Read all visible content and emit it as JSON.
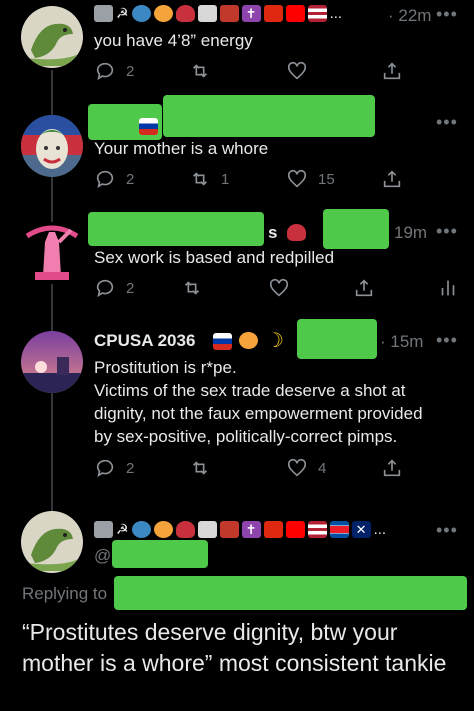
{
  "tweets": [
    {
      "text": "you have 4’8” energy",
      "time": "· 22m",
      "replies": "2",
      "retweets": "",
      "likes": "",
      "more": "•••"
    },
    {
      "text": "Your mother is a whore",
      "time": "",
      "replies": "2",
      "retweets": "1",
      "likes": "15",
      "more": "•••"
    },
    {
      "text": "Sex work is based and redpilled",
      "name_fragment": "s",
      "time": "19m",
      "replies": "2",
      "retweets": "",
      "likes": "",
      "more": "•••"
    },
    {
      "name": "CPUSA 2036",
      "time": "· 15m",
      "text_lines": [
        "Prostitution is r*pe.",
        "Victims of the sex trade deserve a shot at",
        "dignity, not the faux empowerment provided",
        "by sex-positive, politically-correct pimps."
      ],
      "replies": "2",
      "retweets": "",
      "likes": "4",
      "more": "•••"
    },
    {
      "handle_prefix": "@",
      "replying_to": "Replying to",
      "quote": "“Prostitutes deserve dignity, btw your mother is a whore” most consistent tankie",
      "more": "•••"
    }
  ],
  "emoji_ellipsis": "...",
  "icons": [
    "reply-icon",
    "retweet-icon",
    "like-icon",
    "share-icon",
    "analytics-icon"
  ],
  "colors": {
    "background": "#000000",
    "text": "#e7e9ea",
    "muted": "#71767b",
    "redaction": "#4fc94a"
  }
}
